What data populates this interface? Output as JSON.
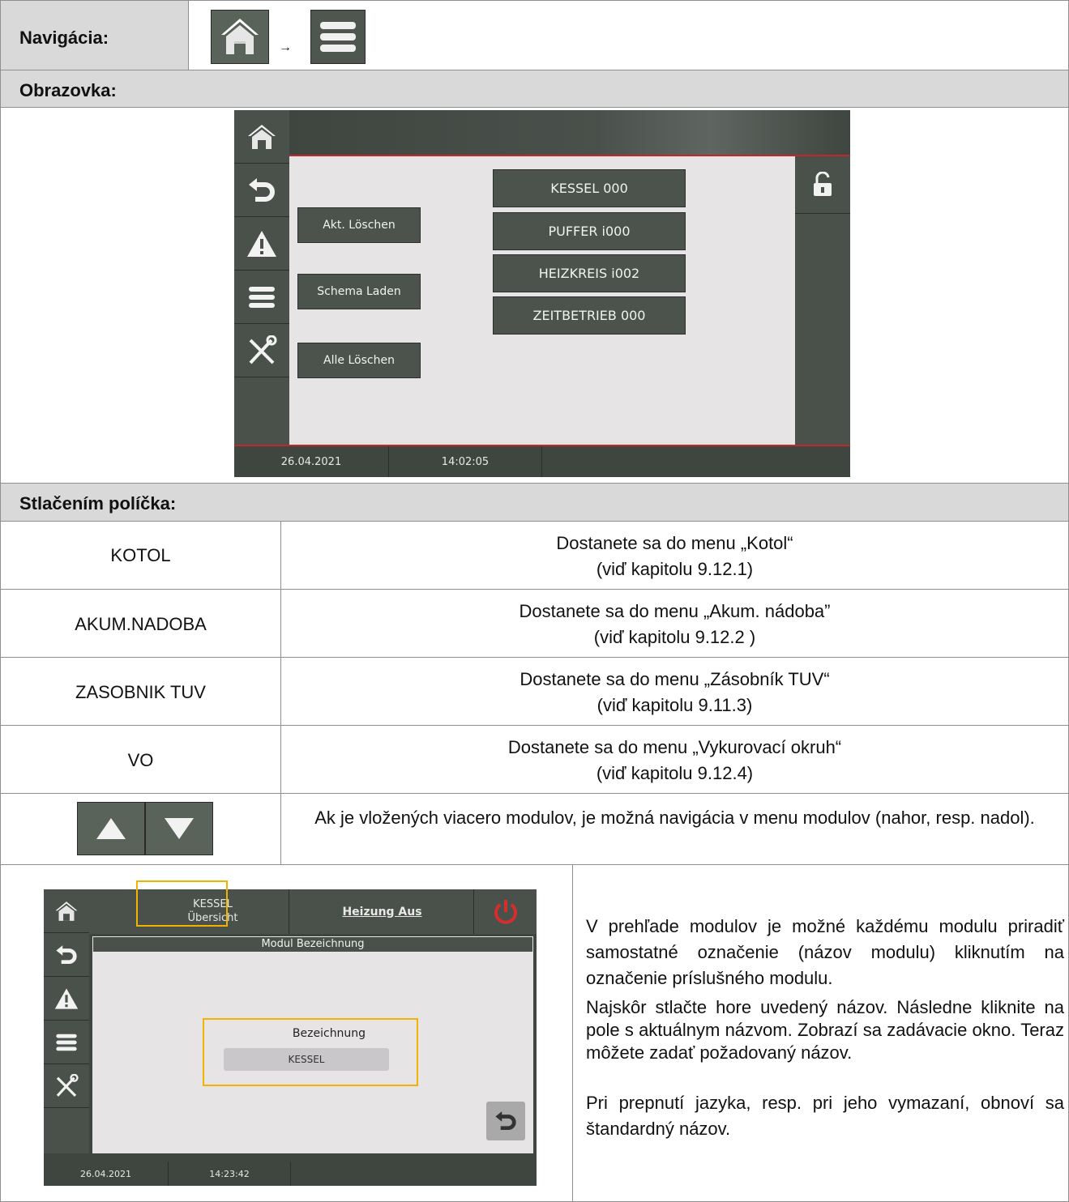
{
  "nav": {
    "label": "Navigácia:",
    "arrow": "→"
  },
  "screen_label": "Obrazovka:",
  "device1": {
    "modules": [
      "KESSEL 000",
      "PUFFER i000",
      "HEIZKREIS i002",
      "ZEITBETRIEB 000"
    ],
    "actions": [
      "Akt. Löschen",
      "Schema Laden",
      "Alle Löschen"
    ],
    "date": "26.04.2021",
    "time": "14:02:05"
  },
  "press_label": "Stlačením políčka:",
  "rows": [
    {
      "field": "KOTOL",
      "desc1": "Dostanete sa do menu „Kotol“",
      "desc2": "(viď kapitolu 9.12.1)"
    },
    {
      "field": "AKUM.NADOBA",
      "desc1": "Dostanete sa do menu „Akum. nádoba”",
      "desc2": "(viď kapitolu 9.12.2 )"
    },
    {
      "field": "ZASOBNIK TUV",
      "desc1": "Dostanete sa do menu „Zásobník TUV“",
      "desc2": "(viď kapitolu 9.11.3)"
    },
    {
      "field": "VO",
      "desc1": "Dostanete sa do menu „Vykurovací okruh“",
      "desc2": "(viď kapitolu 9.12.4)"
    }
  ],
  "arrows_desc": "Ak je vložených viacero modulov, je možná navigácia v menu modulov (nahor, resp. nadol).",
  "device2": {
    "header_module": "KESSEL",
    "header_sub": "Übersicht",
    "heating": "Heizung Aus",
    "title_bar": "Modul Bezeichnung",
    "field_label": "Bezeichnung",
    "field_value": "KESSEL",
    "date": "26.04.2021",
    "time": "14:23:42"
  },
  "explain": {
    "p1": "V prehľade modulov je možné každému modulu priradiť samostatné označenie (názov modulu) kliknutím na označenie príslušného modulu.",
    "p2": "Najskôr stlačte hore uvedený názov. Následne kliknite na pole s aktuálnym názvom. Zobrazí sa zadávacie okno. Teraz môžete zadať požadovaný názov.",
    "p3": "Pri prepnutí jazyka, resp. pri jeho vymazaní, obnoví sa štandardný názov."
  },
  "colors": {
    "header_gray": "#d9d9d9",
    "device_dark": "#4a514b",
    "device_screen": "#e7e4e6",
    "accent_red": "#c0282b",
    "highlight": "#f2b200"
  }
}
